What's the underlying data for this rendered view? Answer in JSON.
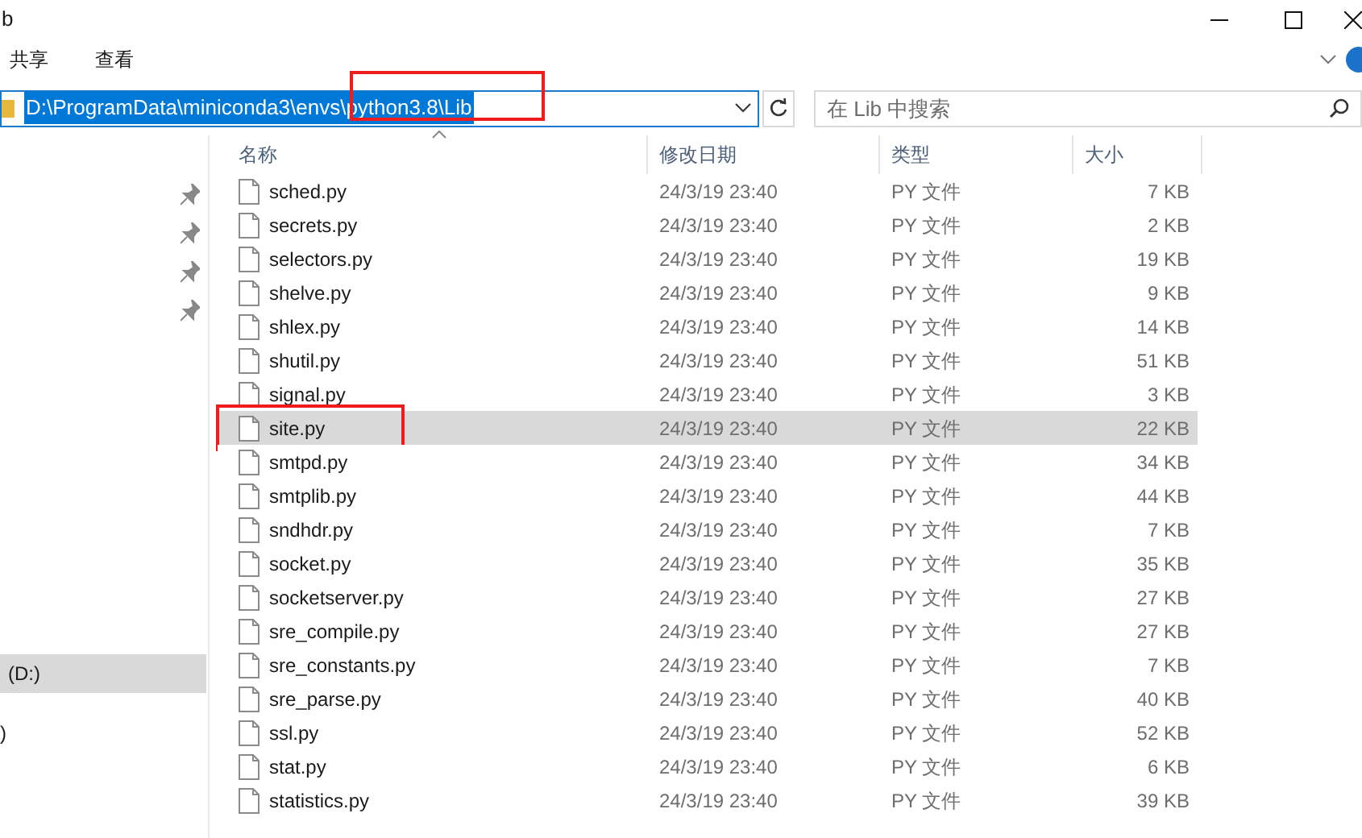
{
  "window": {
    "title": "b"
  },
  "ribbon_tabs": [
    {
      "label": "共享",
      "selected": false
    },
    {
      "label": "查看",
      "selected": false
    }
  ],
  "address": {
    "value": "D:\\ProgramData\\miniconda3\\envs\\python3.8\\Lib",
    "text_selected": true,
    "annotation_box": true
  },
  "search": {
    "placeholder": "在 Lib 中搜索"
  },
  "sidebar": {
    "items": [
      {
        "label": "(D:)",
        "selected": true
      },
      {
        "label": ")",
        "selected": false
      }
    ]
  },
  "table": {
    "columns": [
      {
        "label": "名称"
      },
      {
        "label": "修改日期"
      },
      {
        "label": "类型"
      },
      {
        "label": "大小"
      }
    ],
    "rows": [
      {
        "name": "sched.py",
        "date": "24/3/19 23:40",
        "type": "PY 文件",
        "size": "7 KB",
        "selected": false,
        "annotated": false
      },
      {
        "name": "secrets.py",
        "date": "24/3/19 23:40",
        "type": "PY 文件",
        "size": "2 KB",
        "selected": false,
        "annotated": false
      },
      {
        "name": "selectors.py",
        "date": "24/3/19 23:40",
        "type": "PY 文件",
        "size": "19 KB",
        "selected": false,
        "annotated": false
      },
      {
        "name": "shelve.py",
        "date": "24/3/19 23:40",
        "type": "PY 文件",
        "size": "9 KB",
        "selected": false,
        "annotated": false
      },
      {
        "name": "shlex.py",
        "date": "24/3/19 23:40",
        "type": "PY 文件",
        "size": "14 KB",
        "selected": false,
        "annotated": false
      },
      {
        "name": "shutil.py",
        "date": "24/3/19 23:40",
        "type": "PY 文件",
        "size": "51 KB",
        "selected": false,
        "annotated": false
      },
      {
        "name": "signal.py",
        "date": "24/3/19 23:40",
        "type": "PY 文件",
        "size": "3 KB",
        "selected": false,
        "annotated": false
      },
      {
        "name": "site.py",
        "date": "24/3/19 23:40",
        "type": "PY 文件",
        "size": "22 KB",
        "selected": true,
        "annotated": true
      },
      {
        "name": "smtpd.py",
        "date": "24/3/19 23:40",
        "type": "PY 文件",
        "size": "34 KB",
        "selected": false,
        "annotated": false
      },
      {
        "name": "smtplib.py",
        "date": "24/3/19 23:40",
        "type": "PY 文件",
        "size": "44 KB",
        "selected": false,
        "annotated": false
      },
      {
        "name": "sndhdr.py",
        "date": "24/3/19 23:40",
        "type": "PY 文件",
        "size": "7 KB",
        "selected": false,
        "annotated": false
      },
      {
        "name": "socket.py",
        "date": "24/3/19 23:40",
        "type": "PY 文件",
        "size": "35 KB",
        "selected": false,
        "annotated": false
      },
      {
        "name": "socketserver.py",
        "date": "24/3/19 23:40",
        "type": "PY 文件",
        "size": "27 KB",
        "selected": false,
        "annotated": false
      },
      {
        "name": "sre_compile.py",
        "date": "24/3/19 23:40",
        "type": "PY 文件",
        "size": "27 KB",
        "selected": false,
        "annotated": false
      },
      {
        "name": "sre_constants.py",
        "date": "24/3/19 23:40",
        "type": "PY 文件",
        "size": "7 KB",
        "selected": false,
        "annotated": false
      },
      {
        "name": "sre_parse.py",
        "date": "24/3/19 23:40",
        "type": "PY 文件",
        "size": "40 KB",
        "selected": false,
        "annotated": false
      },
      {
        "name": "ssl.py",
        "date": "24/3/19 23:40",
        "type": "PY 文件",
        "size": "52 KB",
        "selected": false,
        "annotated": false
      },
      {
        "name": "stat.py",
        "date": "24/3/19 23:40",
        "type": "PY 文件",
        "size": "6 KB",
        "selected": false,
        "annotated": false
      },
      {
        "name": "statistics.py",
        "date": "24/3/19 23:40",
        "type": "PY 文件",
        "size": "39 KB",
        "selected": false,
        "annotated": false
      }
    ]
  }
}
